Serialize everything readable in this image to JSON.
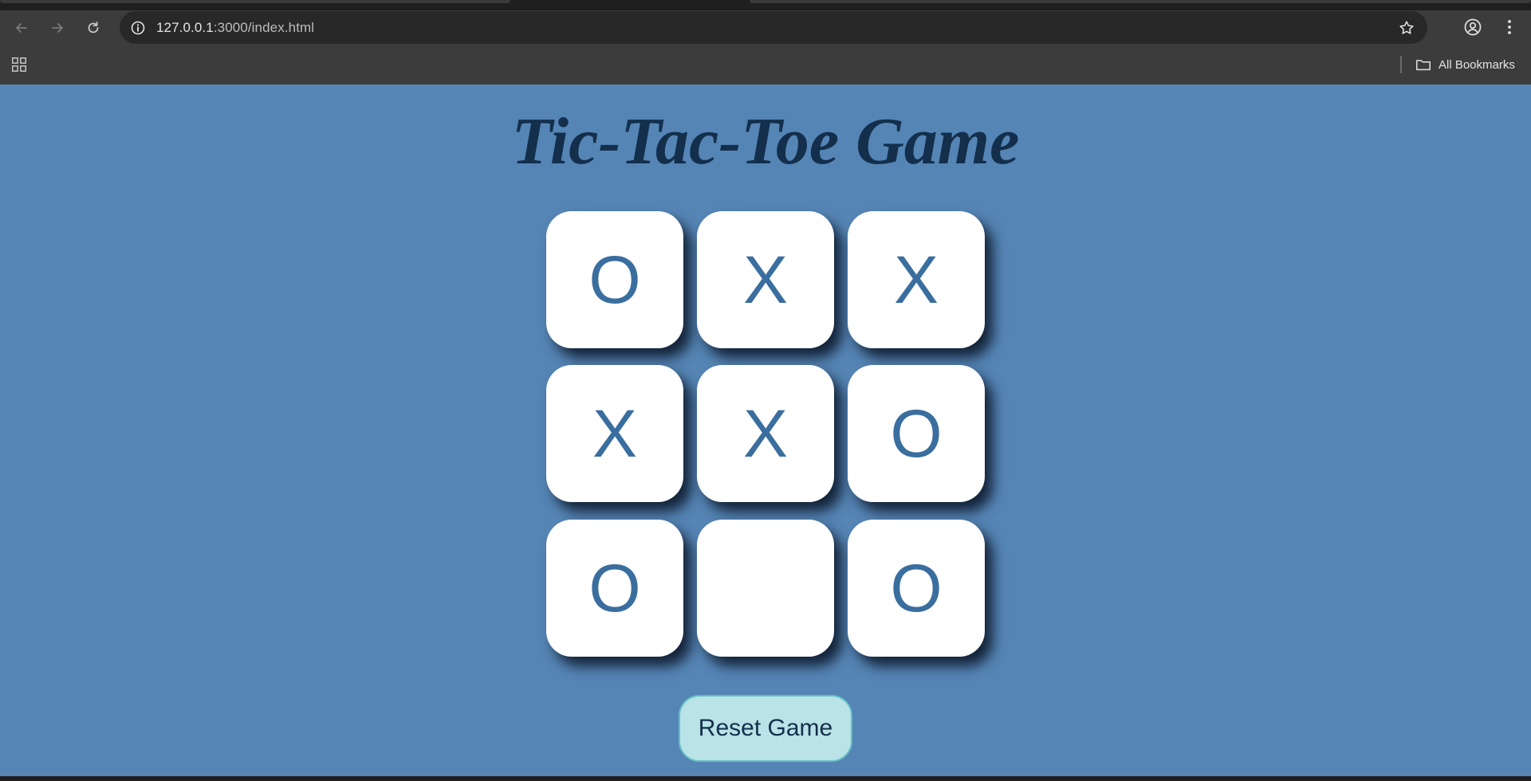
{
  "browser": {
    "url_host": "127.0.0.1",
    "url_path": ":3000/index.html",
    "bookmarks_label": "All Bookmarks",
    "icons": {
      "back": "back-arrow-icon",
      "forward": "forward-arrow-icon",
      "reload": "reload-icon",
      "site_info": "info-icon",
      "bookmark_star": "star-icon",
      "profile": "profile-icon",
      "menu": "kebab-menu-icon",
      "apps": "apps-grid-icon",
      "folder": "folder-icon"
    }
  },
  "page": {
    "title": "Tic-Tac-Toe Game",
    "background_color": "#5585b5",
    "title_color": "#132f4c",
    "mark_color": "#3a6e9f",
    "board": {
      "cells": [
        "O",
        "X",
        "X",
        "X",
        "X",
        "O",
        "O",
        "",
        "O"
      ]
    },
    "reset_label": "Reset Game"
  }
}
